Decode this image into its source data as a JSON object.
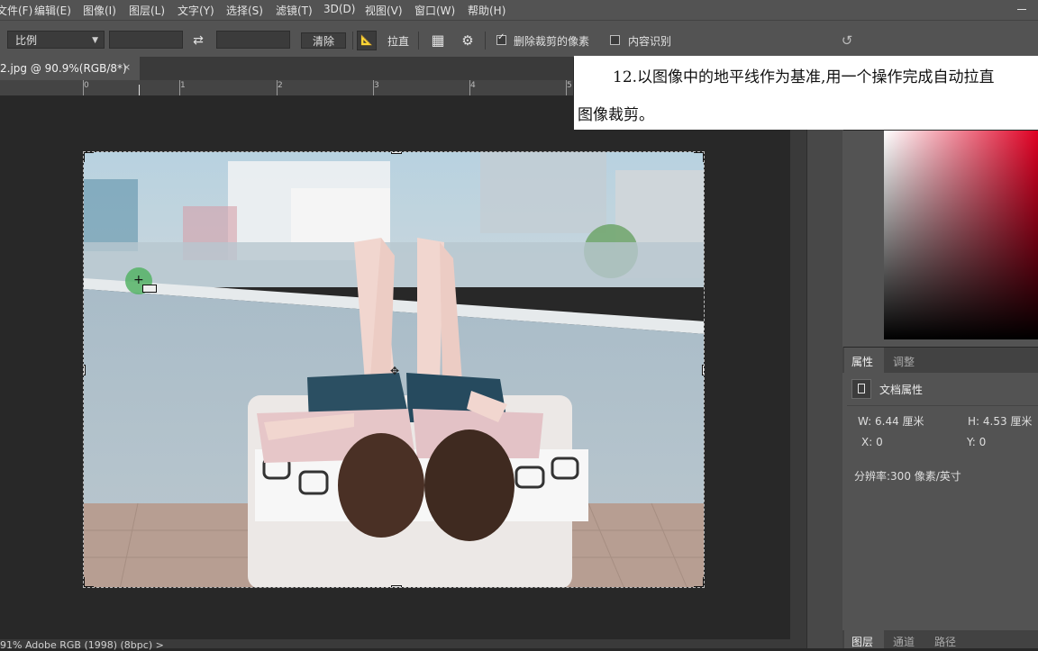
{
  "menu": {
    "items": [
      "文件(F)",
      "编辑(E)",
      "图像(I)",
      "图层(L)",
      "文字(Y)",
      "选择(S)",
      "滤镜(T)",
      "3D(D)",
      "视图(V)",
      "窗口(W)",
      "帮助(H)"
    ]
  },
  "options": {
    "ratio_select": "比例",
    "clear_label": "清除",
    "straighten_label": "拉直",
    "delete_cropped_label": "删除裁剪的像素",
    "delete_cropped_checked": true,
    "content_aware_label": "内容识别",
    "content_aware_checked": false
  },
  "document_tab": {
    "label": "2.jpg @ 90.9%(RGB/8*)",
    "close": "×"
  },
  "ruler": {
    "numbers": [
      "0",
      "1",
      "2",
      "3",
      "4",
      "5"
    ]
  },
  "instruction": {
    "line1": "12.以图像中的地平线作为基准,用一个操作完成自动拉直",
    "line2": "图像裁剪。"
  },
  "properties": {
    "tab_properties": "属性",
    "tab_adjust": "调整",
    "doc_title": "文档属性",
    "width": "W:  6.44 厘米",
    "height": "H:  4.53 厘米",
    "x": "X:  0",
    "y": "Y:  0",
    "resolution": "分辨率:300 像素/英寸"
  },
  "layers_tabs": {
    "layers": "图层",
    "channels": "通道",
    "paths": "路径"
  },
  "status": {
    "text": "91%    Adobe RGB (1998) (8bpc)    >"
  },
  "colors": {
    "ui_dark": "#535353",
    "canvas_bg": "#282828",
    "picker_hue": "#e00023"
  }
}
